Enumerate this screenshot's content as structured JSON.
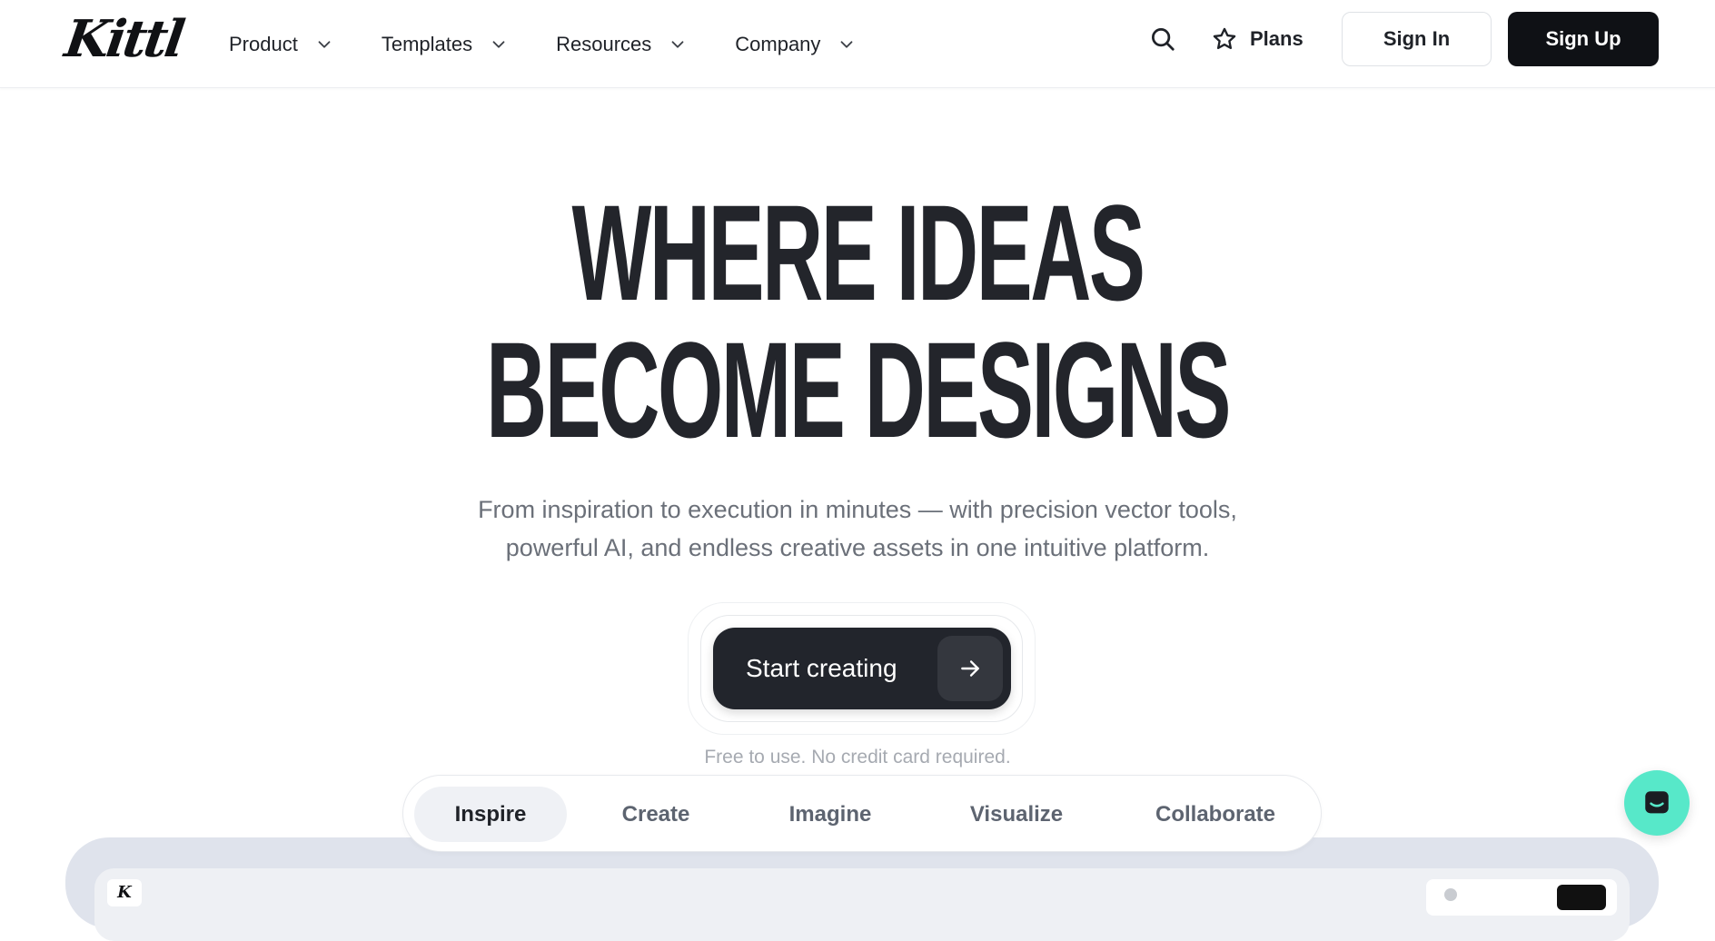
{
  "brand": {
    "logo_text": "Kittl",
    "mini_logo_text": "K"
  },
  "nav": {
    "items": [
      {
        "label": "Product"
      },
      {
        "label": "Templates"
      },
      {
        "label": "Resources"
      },
      {
        "label": "Company"
      }
    ],
    "plans_label": "Plans",
    "signin_label": "Sign In",
    "signup_label": "Sign Up"
  },
  "hero": {
    "headline_line1": "WHERE IDEAS",
    "headline_line2": "BECOME DESIGNS",
    "sub_line1": "From inspiration to execution in minutes — with precision vector tools,",
    "sub_line2": "powerful AI, and endless creative assets in one intuitive platform.",
    "cta_label": "Start creating",
    "note": "Free to use. No credit card required."
  },
  "tabs": [
    {
      "label": "Inspire",
      "active": true
    },
    {
      "label": "Create"
    },
    {
      "label": "Imagine"
    },
    {
      "label": "Visualize"
    },
    {
      "label": "Collaborate"
    }
  ],
  "icons": {
    "search": "search-icon",
    "star": "star-icon",
    "chevron": "chevron-down-icon",
    "arrow": "arrow-right-icon",
    "chat": "chat-icon"
  },
  "colors": {
    "primary_dark": "#0f1115",
    "cta_bg": "#22252c",
    "chat_accent": "#57e8c9",
    "preview_bg": "#dfe3ec"
  }
}
